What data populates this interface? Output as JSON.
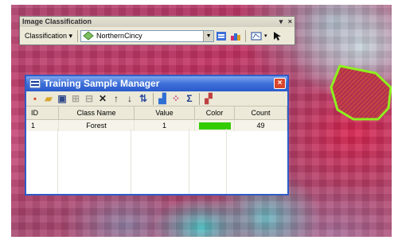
{
  "toolbar": {
    "title": "Image Classification",
    "title_controls": [
      "▾",
      "×"
    ],
    "menu_label": "Classification ▾",
    "layer_value": "NorthernCincy",
    "layer_icon": "raster-layer-icon"
  },
  "tsm": {
    "title": "Training Sample Manager",
    "close_label": "×",
    "tools": [
      {
        "icon": "merge-icon",
        "glyph": "▪"
      },
      {
        "icon": "open-folder-icon",
        "glyph": "▰"
      },
      {
        "icon": "save-icon",
        "glyph": "▣"
      },
      {
        "icon": "split-icon",
        "glyph": "⊞"
      },
      {
        "icon": "merge-classes-icon",
        "glyph": "⊟"
      },
      {
        "icon": "delete-icon",
        "glyph": "✕"
      },
      {
        "icon": "move-up-icon",
        "glyph": "↑"
      },
      {
        "icon": "move-down-icon",
        "glyph": "↓"
      },
      {
        "icon": "reset-order-icon",
        "glyph": "⇅"
      },
      {
        "icon": "histogram-icon",
        "glyph": "▟"
      },
      {
        "icon": "scatterplot-icon",
        "glyph": "⁘"
      },
      {
        "icon": "statistics-icon",
        "glyph": "Σ"
      },
      {
        "icon": "show-class-icon",
        "glyph": "▞"
      }
    ],
    "columns": [
      "ID",
      "Class Name",
      "Value",
      "Color",
      "Count"
    ],
    "rows": [
      {
        "id": "1",
        "class_name": "Forest",
        "value": "1",
        "color": "#33cc00",
        "count": "49"
      }
    ]
  },
  "colors": {
    "polygon_outline": "#8ef01f",
    "polygon_hatch": "#d4523a",
    "titlebar_blue": "#2e5cc6"
  }
}
